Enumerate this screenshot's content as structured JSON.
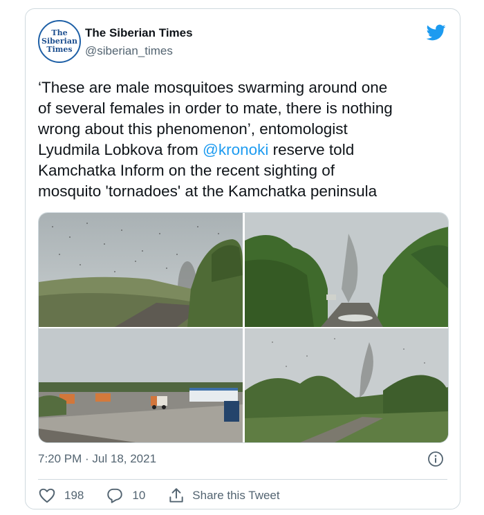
{
  "account": {
    "display_name": "The Siberian Times",
    "handle": "@siberian_times",
    "avatar_lines": [
      "The",
      "Siberian",
      "Times"
    ]
  },
  "tweet": {
    "text_before": "‘These are male mosquitoes swarming around one\nof several females in order to mate, there is nothing\nwrong about this phenomenon’, entomologist\nLyudmila Lobkova from ",
    "mention": "@kronoki",
    "text_after": " reserve told\nKamchatka Inform on the recent sighting of\nmosquito 'tornadoes' at the Kamchatka peninsula",
    "timestamp": "7:20 PM · Jul 18, 2021"
  },
  "media": {
    "photos": [
      "mosquito-swarm-road-photo",
      "mosquito-tornado-trees-photo",
      "mosquito-swarm-lot-photo",
      "mosquito-tornado-field-photo"
    ]
  },
  "actions": {
    "likes": "198",
    "replies": "10",
    "share_label": "Share this Tweet"
  },
  "colors": {
    "accent": "#1d9bf0",
    "text": "#0f1419",
    "secondary": "#536471",
    "border": "#cfd9de"
  },
  "icons": [
    "twitter-bird-icon",
    "info-icon",
    "heart-icon",
    "reply-icon",
    "share-icon"
  ]
}
